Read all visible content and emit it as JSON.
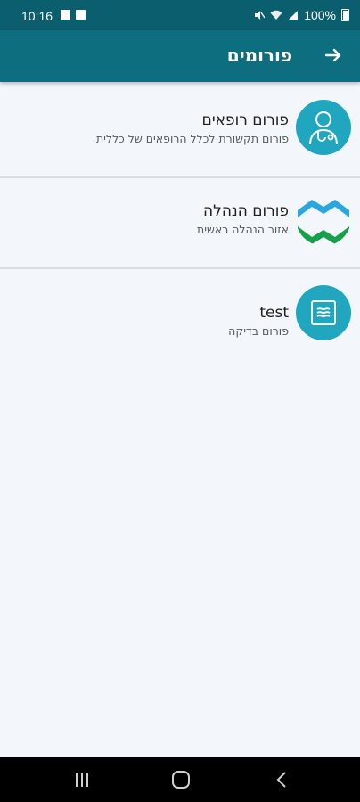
{
  "status": {
    "time": "10:16",
    "battery": "100%"
  },
  "appbar": {
    "title": "פורומים",
    "back_icon": "arrow-right-icon"
  },
  "forums": [
    {
      "name": "פורום רופאים",
      "description": "פורום תקשורת לכלל הרופאים של כללית",
      "icon": "doctor-icon",
      "icon_bg": "#21a6bf"
    },
    {
      "name": "פורום הנהלה",
      "description": "אזור הנהלה ראשית",
      "icon": "clalit-logo-icon",
      "icon_bg": "#ffffff"
    },
    {
      "name": "test",
      "description": "פורום בדיקה",
      "icon": "map-icon",
      "icon_bg": "#21a6bf"
    }
  ],
  "colors": {
    "statusbar": "#0b5e6e",
    "appbar": "#0d6e80",
    "accent": "#21a6bf",
    "background": "#f3f6fa"
  }
}
